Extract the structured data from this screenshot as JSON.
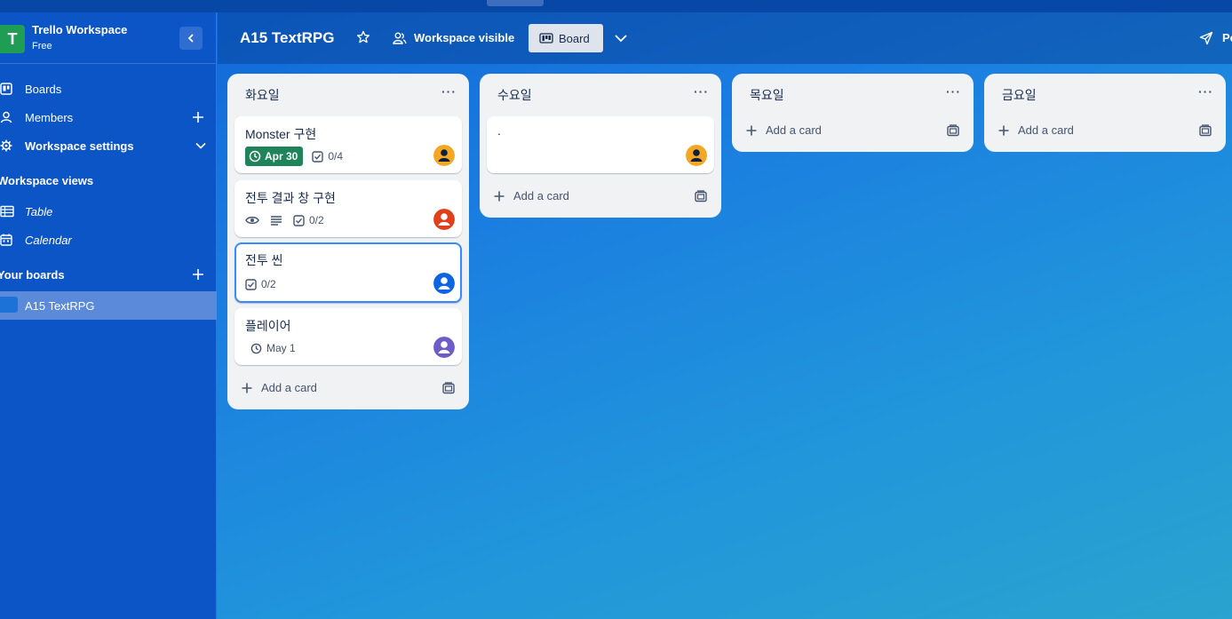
{
  "workspace": {
    "initial": "T",
    "name": "Trello Workspace",
    "plan": "Free"
  },
  "sidebar": {
    "items": [
      {
        "label": "Boards"
      },
      {
        "label": "Members"
      },
      {
        "label": "Workspace settings"
      }
    ],
    "views_title": "Workspace views",
    "views": [
      {
        "label": "Table"
      },
      {
        "label": "Calendar"
      }
    ],
    "boards_title": "Your boards",
    "boards": [
      {
        "label": "A15 TextRPG"
      }
    ]
  },
  "header": {
    "title": "A15 TextRPG",
    "visibility": "Workspace visible",
    "view_label": "Board",
    "power_ups_partial": "Po"
  },
  "lists": [
    {
      "title": "화요일",
      "menu": "···",
      "cards": [
        {
          "title": "Monster 구현",
          "due": "Apr 30",
          "checklist": "0/4",
          "avatar_color": "#f5a623"
        },
        {
          "title": "전투 결과 창 구현",
          "checklist": "0/2",
          "avatar_color": "#e2401b"
        },
        {
          "title": "전투 씬",
          "checklist": "0/2",
          "avatar_color": "#0c66e4"
        },
        {
          "title": "플레이어",
          "due": "May 1",
          "avatar_color": "#6e5dc6"
        }
      ],
      "add_label": "Add a card"
    },
    {
      "title": "수요일",
      "menu": "···",
      "cards": [
        {
          "title": ".",
          "avatar_color": "#f5a623"
        }
      ],
      "add_label": "Add a card"
    },
    {
      "title": "목요일",
      "menu": "···",
      "cards": [],
      "add_label": "Add a card"
    },
    {
      "title": "금요일",
      "menu": "···",
      "cards": [],
      "add_label": "Add a card"
    }
  ],
  "colors": {
    "due_green": "#1f845a",
    "focus_blue": "#388bff",
    "sidebar_bg": "#0c55c6"
  }
}
